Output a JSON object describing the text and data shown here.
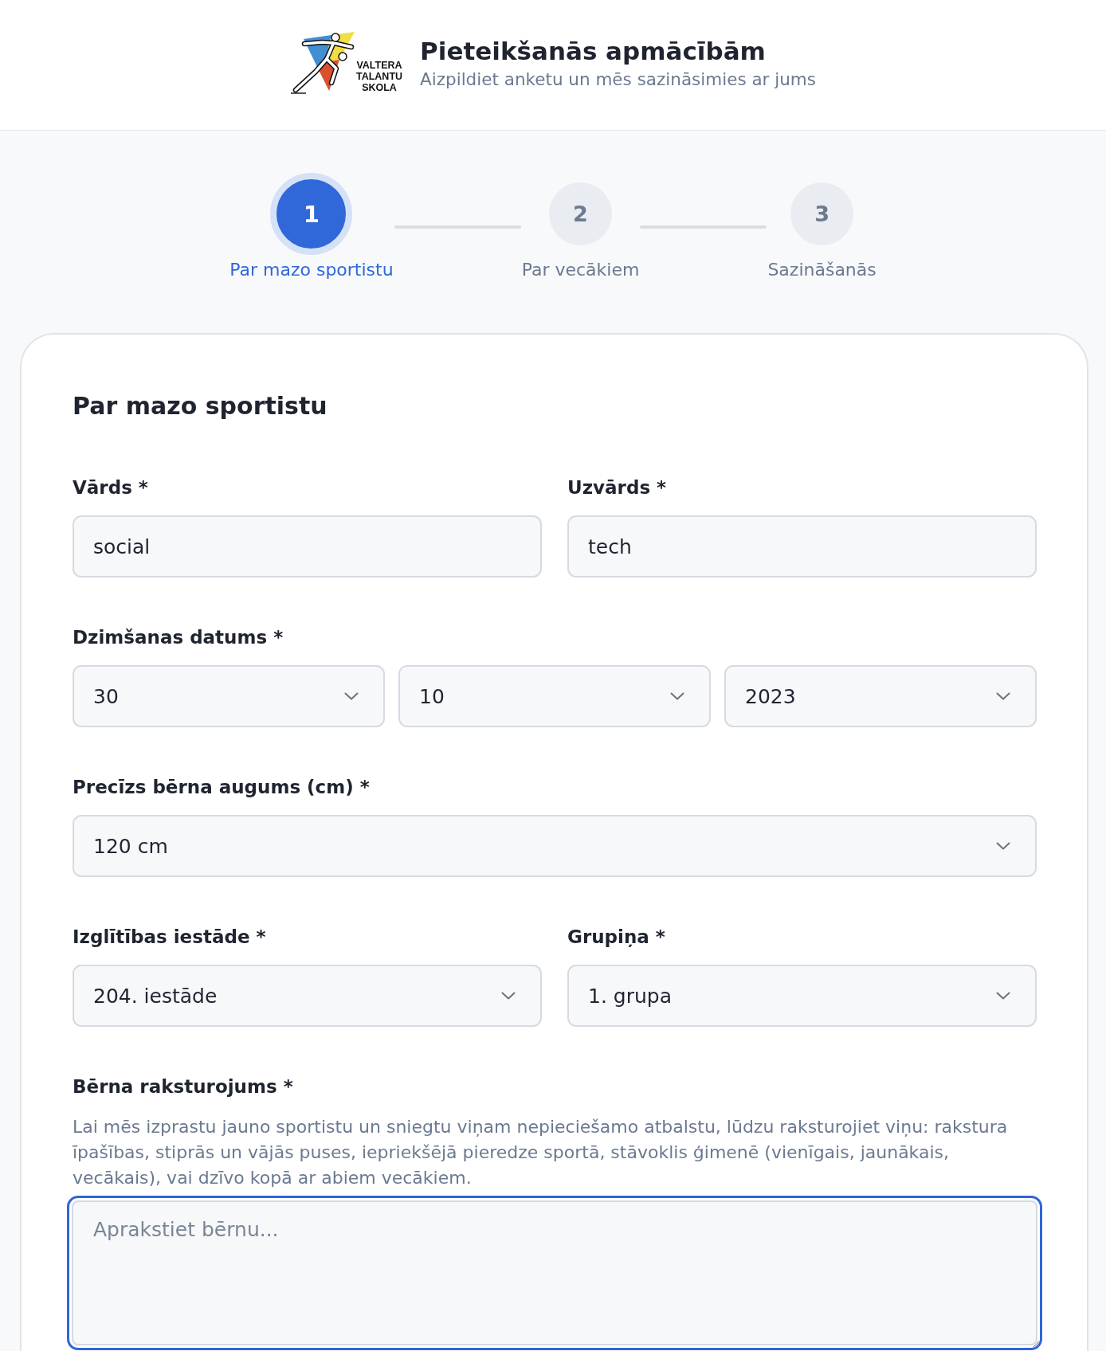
{
  "header": {
    "logo": {
      "lines": [
        "VALTERA",
        "TALANTU",
        "SKOLA"
      ]
    },
    "title": "Pieteikšanās apmācībām",
    "subtitle": "Aizpildiet anketu un mēs sazināsimies ar jums"
  },
  "steps": [
    {
      "number": "1",
      "label": "Par mazo sportistu",
      "selected": true
    },
    {
      "number": "2",
      "label": "Par vecākiem",
      "selected": false
    },
    {
      "number": "3",
      "label": "Sazināšanās",
      "selected": false
    }
  ],
  "form": {
    "title": "Par mazo sportistu",
    "rows": [
      {
        "fields": [
          {
            "kind": "text",
            "label": "Vārds *",
            "value": "social"
          },
          {
            "kind": "text",
            "label": "Uzvārds *",
            "value": "tech"
          }
        ]
      },
      {
        "fields": [
          {
            "kind": "date",
            "label": "Dzimšanas datums *",
            "parts": [
              {
                "value": "30"
              },
              {
                "value": "10"
              },
              {
                "value": "2023"
              }
            ]
          }
        ]
      },
      {
        "fields": [
          {
            "kind": "select",
            "label": "Precīzs bērna augums (cm) *",
            "value": "120 cm"
          }
        ]
      },
      {
        "fields": [
          {
            "kind": "select",
            "label": "Izglītības iestāde *",
            "value": "204. iestāde"
          },
          {
            "kind": "select",
            "label": "Grupiņa *",
            "value": "1. grupa"
          }
        ]
      },
      {
        "fields": [
          {
            "kind": "textarea",
            "label": "Bērna raksturojums *",
            "hint": "Lai mēs izprastu jauno sportistu un sniegtu viņam nepieciešamo atbalstu, lūdzu raksturojiet viņu: rakstura īpašības, stiprās un vājās puses, iepriekšējā pieredze sportā, stāvoklis ģimenē (vienīgais, jaunākais, vecākais), vai dzīvo kopā ar abiem vecākiem.",
            "placeholder": "Aprakstiet bērnu...",
            "focused": true
          }
        ]
      }
    ]
  }
}
